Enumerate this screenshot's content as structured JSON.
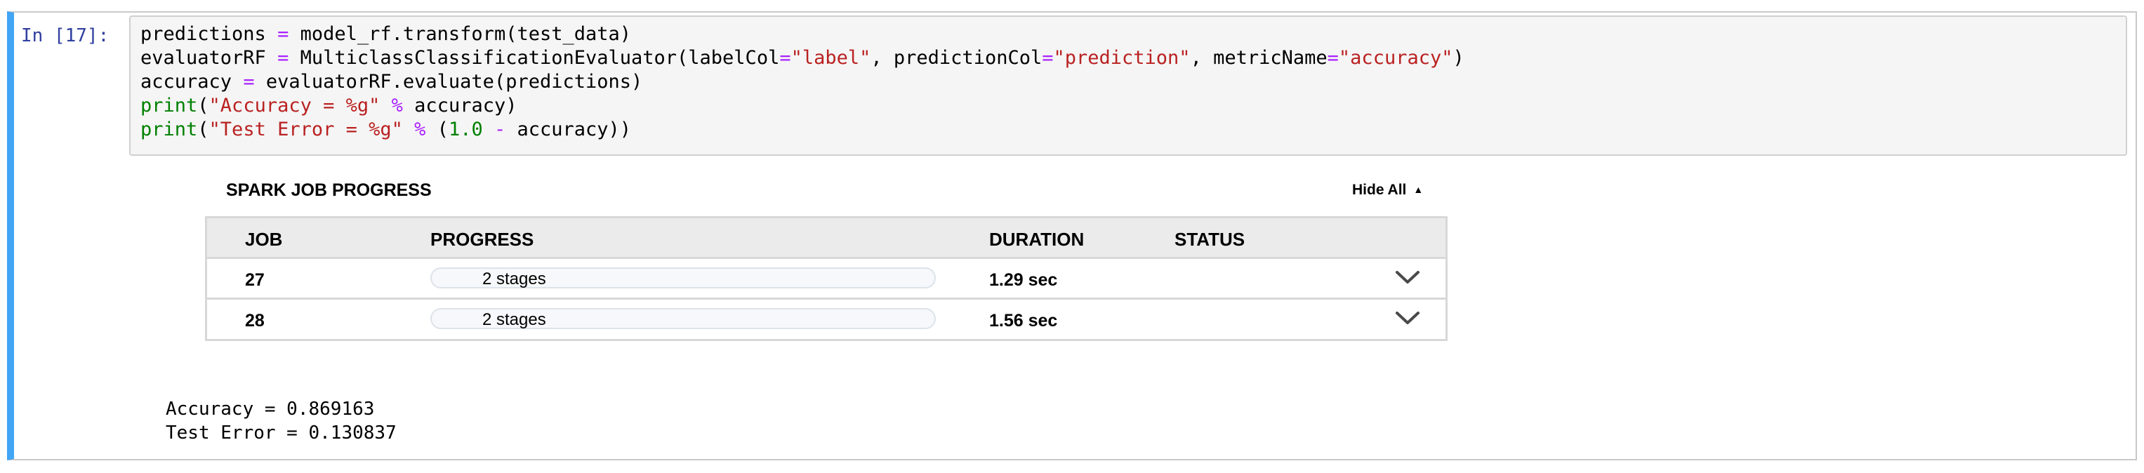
{
  "cell": {
    "prompt": "In [17]:",
    "code_lines": [
      [
        {
          "t": "predictions ",
          "c": "plain"
        },
        {
          "t": "=",
          "c": "op"
        },
        {
          "t": " model_rf.transform(test_data)",
          "c": "plain"
        }
      ],
      [
        {
          "t": "evaluatorRF ",
          "c": "plain"
        },
        {
          "t": "=",
          "c": "op"
        },
        {
          "t": " MulticlassClassificationEvaluator(labelCol",
          "c": "plain"
        },
        {
          "t": "=",
          "c": "op"
        },
        {
          "t": "\"label\"",
          "c": "str"
        },
        {
          "t": ", predictionCol",
          "c": "plain"
        },
        {
          "t": "=",
          "c": "op"
        },
        {
          "t": "\"prediction\"",
          "c": "str"
        },
        {
          "t": ", metricName",
          "c": "plain"
        },
        {
          "t": "=",
          "c": "op"
        },
        {
          "t": "\"accuracy\"",
          "c": "str"
        },
        {
          "t": ")",
          "c": "plain"
        }
      ],
      [
        {
          "t": "accuracy ",
          "c": "plain"
        },
        {
          "t": "=",
          "c": "op"
        },
        {
          "t": " evaluatorRF.evaluate(predictions)",
          "c": "plain"
        }
      ],
      [
        {
          "t": "print",
          "c": "bi"
        },
        {
          "t": "(",
          "c": "plain"
        },
        {
          "t": "\"Accuracy = %g\"",
          "c": "str"
        },
        {
          "t": " ",
          "c": "plain"
        },
        {
          "t": "%",
          "c": "op"
        },
        {
          "t": " accuracy)",
          "c": "plain"
        }
      ],
      [
        {
          "t": "print",
          "c": "bi"
        },
        {
          "t": "(",
          "c": "plain"
        },
        {
          "t": "\"Test Error = %g\"",
          "c": "str"
        },
        {
          "t": " ",
          "c": "plain"
        },
        {
          "t": "%",
          "c": "op"
        },
        {
          "t": " (",
          "c": "plain"
        },
        {
          "t": "1.0",
          "c": "num"
        },
        {
          "t": " ",
          "c": "plain"
        },
        {
          "t": "-",
          "c": "op"
        },
        {
          "t": " accuracy))",
          "c": "plain"
        }
      ]
    ]
  },
  "spark": {
    "title": "SPARK JOB PROGRESS",
    "hide_all_label": "Hide All",
    "columns": {
      "job": "JOB",
      "progress": "PROGRESS",
      "duration": "DURATION",
      "status": "STATUS"
    },
    "jobs": [
      {
        "job": "27",
        "progress_label": "2 stages",
        "duration": "1.29 sec",
        "status": "",
        "progress_fraction": 0
      },
      {
        "job": "28",
        "progress_label": "2 stages",
        "duration": "1.56 sec",
        "status": "",
        "progress_fraction": 0
      }
    ]
  },
  "output": {
    "lines": [
      "Accuracy = 0.869163",
      "Test Error = 0.130837"
    ]
  },
  "colors": {
    "cell_accent": "#42a5f5",
    "prompt": "#303f9f",
    "operator": "#aa22ff",
    "string": "#ba2121",
    "number": "#008000",
    "builtin": "#008000"
  },
  "icons": {
    "collapse": "triangle-up-icon",
    "expand_row": "chevron-down-icon"
  }
}
